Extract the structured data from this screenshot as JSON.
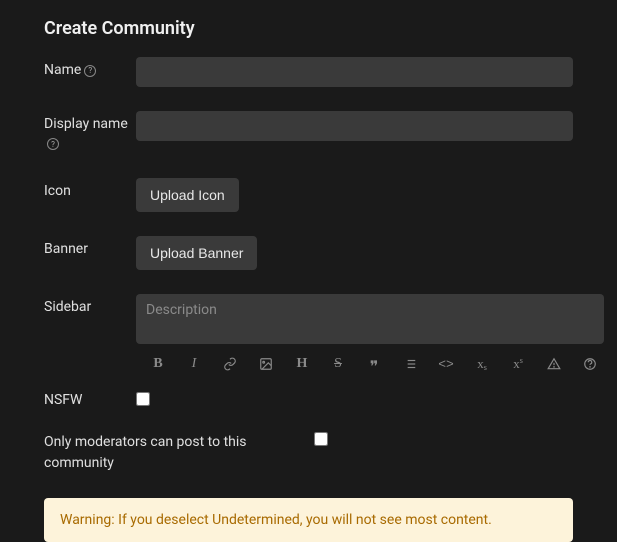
{
  "title": "Create Community",
  "labels": {
    "name": "Name",
    "display_name": "Display name",
    "icon": "Icon",
    "banner": "Banner",
    "sidebar": "Sidebar",
    "nsfw": "NSFW",
    "mods_only": "Only moderators can post to this community"
  },
  "buttons": {
    "upload_icon": "Upload Icon",
    "upload_banner": "Upload Banner"
  },
  "fields": {
    "name_value": "",
    "display_name_value": "",
    "sidebar_value": "",
    "sidebar_placeholder": "Description"
  },
  "checkboxes": {
    "nsfw": false,
    "mods_only": false
  },
  "toolbar": {
    "bold": "B",
    "italic": "I",
    "link": "link",
    "image": "image",
    "header": "H",
    "strike": "S",
    "quote": "quote",
    "list": "list",
    "code": "code",
    "sub": "x",
    "sub_suffix": "s",
    "sup": "x",
    "sup_suffix": "s",
    "spoiler": "spoiler",
    "help": "?"
  },
  "warning": "Warning: If you deselect Undetermined, you will not see most content."
}
